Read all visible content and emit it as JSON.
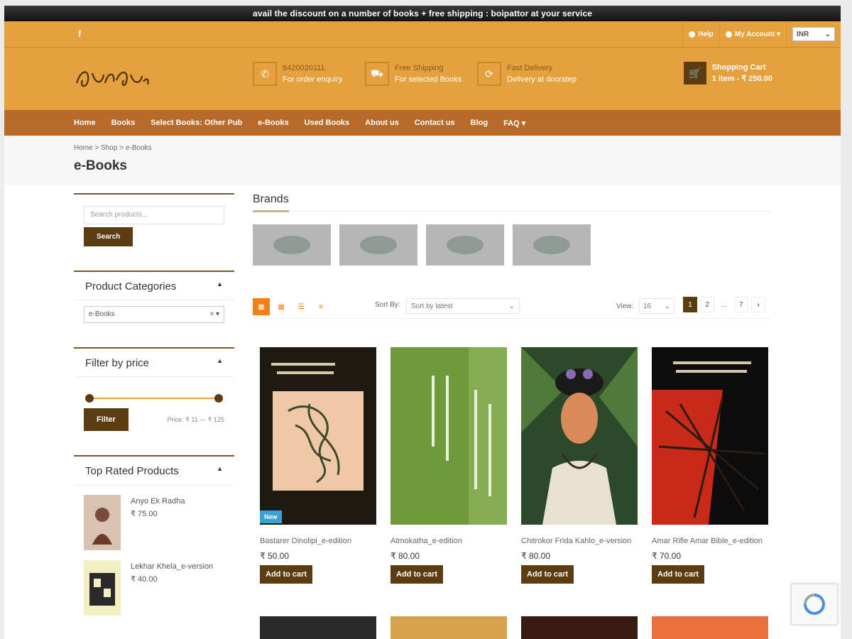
{
  "promo": "avail the discount on a number of books + free shipping : boipattor at your service",
  "topbar": {
    "facebook": "f",
    "help": "Help",
    "account": "My Account ▾",
    "currency": "INR"
  },
  "header": {
    "features": [
      {
        "icon": "phone-icon",
        "line1": "8420020111",
        "line2": "For order enquiry"
      },
      {
        "icon": "truck-icon",
        "line1": "Free Shipping",
        "line2": "For selected Books"
      },
      {
        "icon": "refresh-icon",
        "line1": "Fast Delivery",
        "line2": "Delivery at doorstep"
      }
    ],
    "cart": {
      "title": "Shopping Cart",
      "summary": "1 item - ₹ 250.00"
    }
  },
  "nav": [
    "Home",
    "Books",
    "Select Books: Other Pub",
    "e-Books",
    "Used Books",
    "About us",
    "Contact us",
    "Blog",
    "FAQ ▾"
  ],
  "breadcrumb": "Home > Shop > e-Books",
  "page_title": "e-Books",
  "sidebar": {
    "search_placeholder": "Search products...",
    "search_button": "Search",
    "categories_title": "Product Categories",
    "categories_selected": "e-Books",
    "price_title": "Filter by price",
    "filter_button": "Filter",
    "price_range": "Price: ₹ 11 — ₹ 125",
    "top_rated_title": "Top Rated Products",
    "top_rated": [
      {
        "name": "Anyo Ek Radha",
        "price": "₹ 75.00"
      },
      {
        "name": "Lekhar Khela_e-version",
        "price": "₹ 40.00"
      }
    ]
  },
  "content": {
    "brands_title": "Brands",
    "sort_label": "Sort By:",
    "sort_value": "Sort by latest",
    "view_label": "View:",
    "view_value": "16",
    "pages": [
      "1",
      "2",
      "...",
      "7",
      "›"
    ],
    "products": [
      {
        "name": "Bastarer Dinolipi_e-edition",
        "price": "₹ 50.00",
        "cart": "Add to cart",
        "badge": "New"
      },
      {
        "name": "Atmokatha_e-edition",
        "price": "₹ 80.00",
        "cart": "Add to cart"
      },
      {
        "name": "Chitrokor Frida Kahlo_e-version",
        "price": "₹ 80.00",
        "cart": "Add to cart"
      },
      {
        "name": "Amar Rifle Amar Bible_e-edition",
        "price": "₹ 70.00",
        "cart": "Add to cart"
      }
    ]
  },
  "colors": {
    "bar": "#e4a13e",
    "nav": "#b86a2a",
    "button": "#5c3d11",
    "accent": "#f07f14"
  }
}
